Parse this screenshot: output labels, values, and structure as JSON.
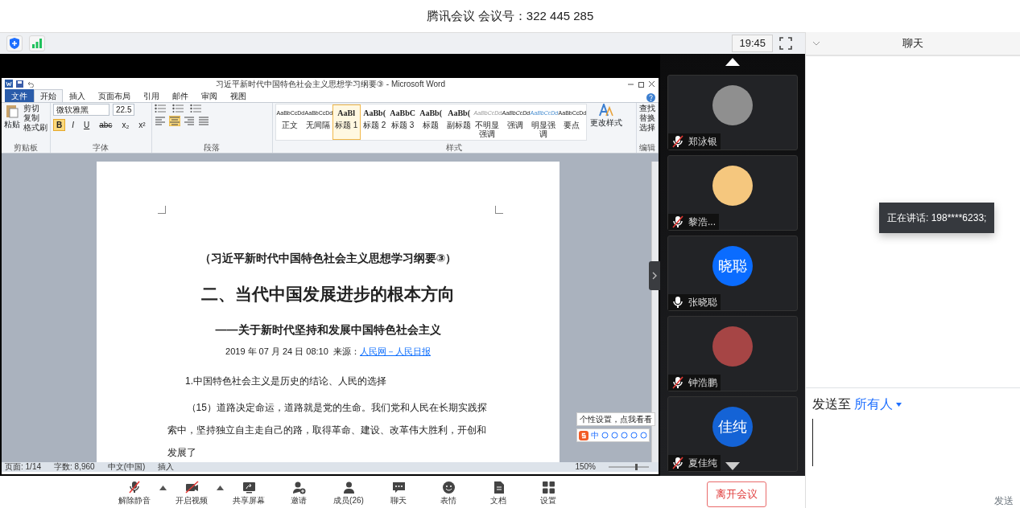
{
  "meeting_title": "腾讯会议 会议号：322 445 285",
  "top_bar": {
    "time": "19:45"
  },
  "word": {
    "title": "习近平新时代中国特色社会主义思想学习纲要③ - Microsoft Word",
    "tabs": [
      {
        "label": "文件",
        "selected": false,
        "kind": "file"
      },
      {
        "label": "开始",
        "selected": true,
        "kind": "tab"
      },
      {
        "label": "插入",
        "selected": false,
        "kind": "tab"
      },
      {
        "label": "页面布局",
        "selected": false,
        "kind": "tab"
      },
      {
        "label": "引用",
        "selected": false,
        "kind": "tab"
      },
      {
        "label": "邮件",
        "selected": false,
        "kind": "tab"
      },
      {
        "label": "审阅",
        "selected": false,
        "kind": "tab"
      },
      {
        "label": "视图",
        "selected": false,
        "kind": "tab"
      }
    ],
    "clipboard": {
      "paste": "粘贴",
      "items": [
        "剪切",
        "复制",
        "格式刷"
      ],
      "group": "剪贴板"
    },
    "font": {
      "name": "微软雅黑",
      "size": "22.5",
      "group": "字体",
      "buttons": [
        {
          "label": "B",
          "selected": true
        },
        {
          "label": "I",
          "selected": false
        },
        {
          "label": "U",
          "selected": false
        },
        {
          "label": "abc",
          "selected": false
        },
        {
          "label": "x₂",
          "selected": false
        },
        {
          "label": "x²",
          "selected": false
        }
      ]
    },
    "paragraph": {
      "group": "段落",
      "align": [
        {
          "kind": "left",
          "selected": false
        },
        {
          "kind": "center",
          "selected": true
        },
        {
          "kind": "right",
          "selected": false
        },
        {
          "kind": "justify",
          "selected": false
        }
      ]
    },
    "styles": {
      "group": "样式",
      "change": "更改样式",
      "items": [
        {
          "preview": "AaBbCcDd",
          "name": "正文",
          "selected": false,
          "kind": "small"
        },
        {
          "preview": "AaBbCcDd",
          "name": "无间隔",
          "selected": false,
          "kind": "small"
        },
        {
          "preview": "AaBl",
          "name": "标题 1",
          "selected": true,
          "kind": "large"
        },
        {
          "preview": "AaBb(",
          "name": "标题 2",
          "selected": false,
          "kind": "large"
        },
        {
          "preview": "AaBbC",
          "name": "标题 3",
          "selected": false,
          "kind": "large"
        },
        {
          "preview": "AaBb(",
          "name": "标题",
          "selected": false,
          "kind": "large"
        },
        {
          "preview": "AaBb(",
          "name": "副标题",
          "selected": false,
          "kind": "large"
        },
        {
          "preview": "AaBbCcDd",
          "name": "不明显强调",
          "selected": false,
          "kind": "faint"
        },
        {
          "preview": "AaBbCcDd",
          "name": "强调",
          "selected": false,
          "kind": "italic"
        },
        {
          "preview": "AaBbCcDd",
          "name": "明显强调",
          "selected": false,
          "kind": "accent"
        },
        {
          "preview": "AaBbCcDd",
          "name": "要点",
          "selected": false,
          "kind": "small"
        }
      ]
    },
    "editing": {
      "group": "编辑",
      "items": [
        "查找",
        "替换",
        "选择"
      ]
    },
    "document": {
      "heading": "（习近平新时代中国特色社会主义思想学习纲要③）",
      "title": "二、当代中国发展进步的根本方向",
      "subtitle": "——关于新时代坚持和发展中国特色社会主义",
      "byline": "2019 年 07 月 24 日 08:10  来源：",
      "source_link": "人民网－人民日报",
      "section": "1.中国特色社会主义是历史的结论、人民的选择",
      "paragraph": "（15）道路决定命运，道路就是党的生命。我们党和人民在长期实践探索中，坚持独立自主走自己的路，取得革命、建设、改革伟大胜利，开创和发展了"
    },
    "ime": {
      "tooltip": "个性设置，点我看看",
      "mode": "中"
    },
    "status": {
      "page": "页面: 1/14",
      "words": "字数: 8,960",
      "language": "中文(中国)",
      "mode": "插入",
      "zoom": "150%"
    }
  },
  "participants": [
    {
      "name": "郑泳银",
      "muted": true,
      "avatar": {
        "kind": "image",
        "color": "#8f8f8f"
      }
    },
    {
      "name": "黎浩...",
      "muted": true,
      "avatar": {
        "kind": "image",
        "color": "#f5c77e"
      }
    },
    {
      "name": "张晓聪",
      "muted": false,
      "avatar": {
        "kind": "initials",
        "text": "晓聪",
        "color": "#0a6cff"
      }
    },
    {
      "name": "钟浩鹏",
      "muted": true,
      "avatar": {
        "kind": "image",
        "color": "#a64545"
      }
    },
    {
      "name": "夏佳纯",
      "muted": true,
      "avatar": {
        "kind": "initials",
        "text": "佳纯",
        "color": "#1463d6"
      }
    }
  ],
  "speaking_tooltip": "正在讲话: 198****6233;",
  "chat": {
    "title": "聊天",
    "send_to": "发送至",
    "recipient": "所有人",
    "send_button": "发送"
  },
  "toolbar": {
    "items": [
      {
        "label": "解除静音",
        "kind": "mic",
        "off": true,
        "has_menu": true
      },
      {
        "label": "开启视频",
        "kind": "video",
        "off": true,
        "has_menu": true
      },
      {
        "label": "共享屏幕",
        "kind": "share",
        "off": false,
        "has_menu": false
      },
      {
        "label": "邀请",
        "kind": "invite",
        "off": false,
        "has_menu": false
      },
      {
        "label": "成员(26)",
        "kind": "members",
        "off": false,
        "has_menu": false
      },
      {
        "label": "聊天",
        "kind": "chat",
        "off": false,
        "has_menu": false
      },
      {
        "label": "表情",
        "kind": "emoji",
        "off": false,
        "has_menu": false
      },
      {
        "label": "文档",
        "kind": "doc",
        "off": false,
        "has_menu": false
      },
      {
        "label": "设置",
        "kind": "settings",
        "off": false,
        "has_menu": false
      }
    ],
    "leave": "离开会议"
  }
}
